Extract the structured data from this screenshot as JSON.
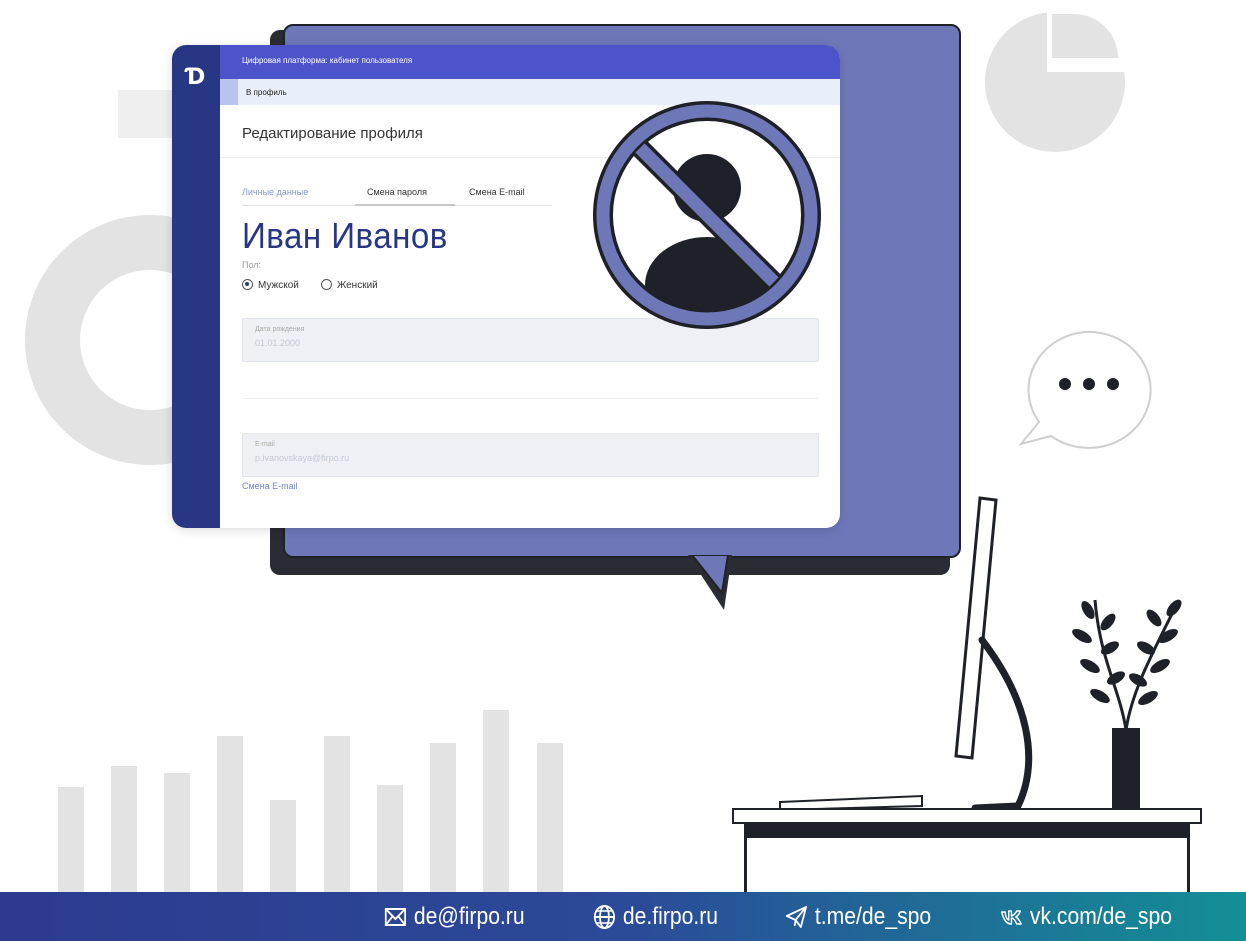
{
  "window": {
    "title": "Цифровая платформа: кабинет пользователя",
    "breadcrumb": "В профиль",
    "page_title": "Редактирование профиля",
    "logo_icon": "d-logo-icon"
  },
  "tabs": [
    {
      "label": "Личные данные",
      "active": true
    },
    {
      "label": "Смена пароля",
      "active": false
    },
    {
      "label": "Смена E-mail",
      "active": false
    }
  ],
  "profile": {
    "name": "Иван Иванов",
    "gender_label": "Пол:",
    "gender_options": [
      {
        "label": "Мужской",
        "selected": true
      },
      {
        "label": "Женский",
        "selected": false
      }
    ],
    "birth_date_label": "Дата рождения",
    "birth_date_value": "01.01.2000",
    "email_label": "E-mail",
    "email_value": "p.ivanovskaya@firpo.ru",
    "change_email_link": "Смена E-mail"
  },
  "footer": {
    "email": "de@firpo.ru",
    "site": "de.firpo.ru",
    "telegram": "t.me/de_spo",
    "vk": "vk.com/de_spo",
    "icons": [
      "mail-icon",
      "globe-icon",
      "telegram-icon",
      "vk-icon"
    ]
  },
  "colors": {
    "sidebar": "#283783",
    "topbar": "#4d54c9",
    "bubble": "#6e78b8",
    "name": "#283783",
    "footer_start": "#2c3a8f",
    "footer_end": "#138f96"
  }
}
